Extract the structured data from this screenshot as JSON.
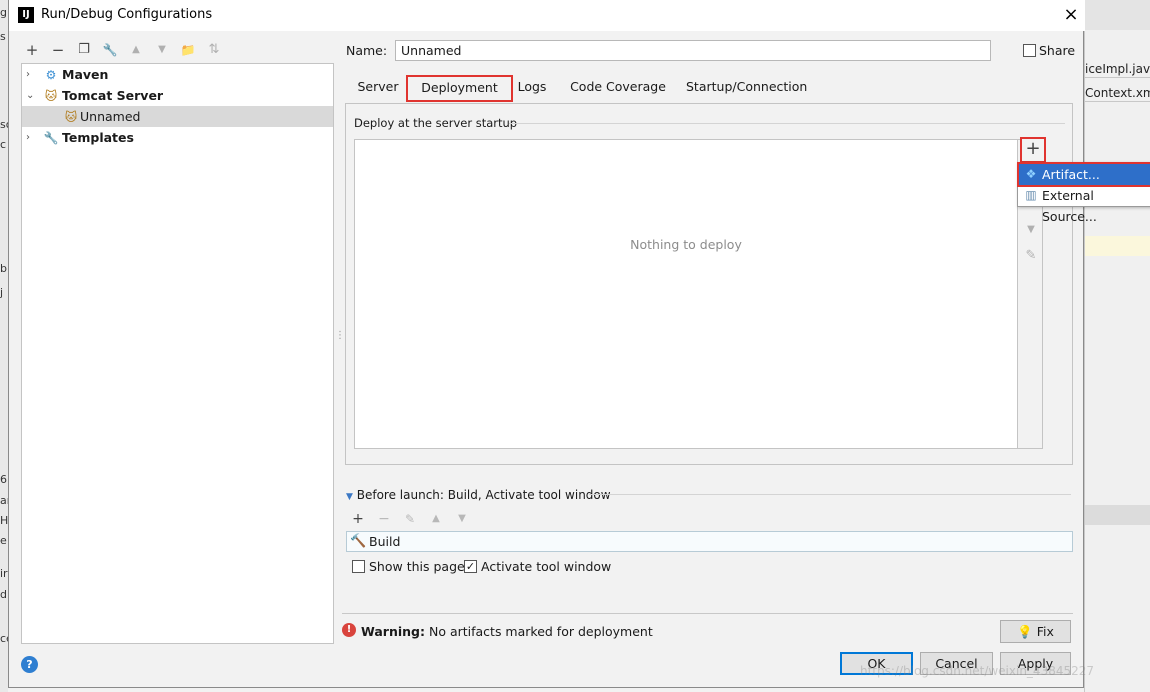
{
  "window": {
    "title": "Run/Debug Configurations",
    "app_icon_text": "IJ",
    "close_icon": "×"
  },
  "left_toolbar": {
    "icons": [
      {
        "name": "add-icon",
        "glyph": "+"
      },
      {
        "name": "remove-icon",
        "glyph": "−"
      },
      {
        "name": "copy-icon",
        "glyph": "❐"
      },
      {
        "name": "wrench-icon",
        "glyph": "🔧"
      },
      {
        "name": "move-up-icon",
        "glyph": "▲"
      },
      {
        "name": "move-down-icon",
        "glyph": "▼"
      },
      {
        "name": "folder-icon",
        "glyph": "📁"
      },
      {
        "name": "sort-icon",
        "glyph": "⇅"
      }
    ]
  },
  "tree": {
    "items": [
      {
        "label": "Maven",
        "icon": "gear-icon",
        "expanded": false
      },
      {
        "label": "Tomcat Server",
        "icon": "tomcat-icon",
        "expanded": true
      },
      {
        "label": "Unnamed",
        "icon": "tomcat-icon",
        "selected": true
      },
      {
        "label": "Templates",
        "icon": "wrench-icon",
        "expanded": false
      }
    ]
  },
  "config": {
    "name_label": "Name:",
    "name_value": "Unnamed",
    "share_label": "Share",
    "share_checked": false
  },
  "tabs": [
    {
      "label": "Server"
    },
    {
      "label": "Deployment",
      "active": true
    },
    {
      "label": "Logs"
    },
    {
      "label": "Code Coverage"
    },
    {
      "label": "Startup/Connection"
    }
  ],
  "deployment": {
    "group_title": "Deploy at the server startup",
    "empty_text": "Nothing to deploy",
    "add_glyph": "+"
  },
  "popup": {
    "items": [
      {
        "label": "Artifact...",
        "icon": "artifact-icon",
        "selected": true
      },
      {
        "label": "External Source...",
        "icon": "external-source-icon"
      }
    ]
  },
  "before_launch": {
    "title": "Before launch: Build, Activate tool window",
    "items": [
      {
        "label": "Build",
        "icon": "hammer-icon"
      }
    ],
    "show_page_label": "Show this page",
    "show_page_checked": false,
    "activate_label": "Activate tool window",
    "activate_checked": true
  },
  "warning": {
    "bold": "Warning:",
    "text": "No artifacts marked for deployment",
    "fix_label": "Fix"
  },
  "buttons": {
    "ok": "OK",
    "cancel": "Cancel",
    "apply": "Apply"
  },
  "background_ide": {
    "right_tabs": [
      "iceImpl.java",
      "Context.xml"
    ],
    "left_fragments": [
      "g",
      "s",
      "so",
      "c",
      "b",
      "j",
      "6",
      "ar",
      "H",
      "e",
      "ir",
      "d",
      "ce"
    ]
  },
  "watermark": "https://blog.csdn.net/weixin_43845227",
  "colors": {
    "highlight_red": "#e0342f",
    "selection_blue": "#2e6fc9",
    "default_button": "#0078d7",
    "warning_red": "#d9443d"
  }
}
